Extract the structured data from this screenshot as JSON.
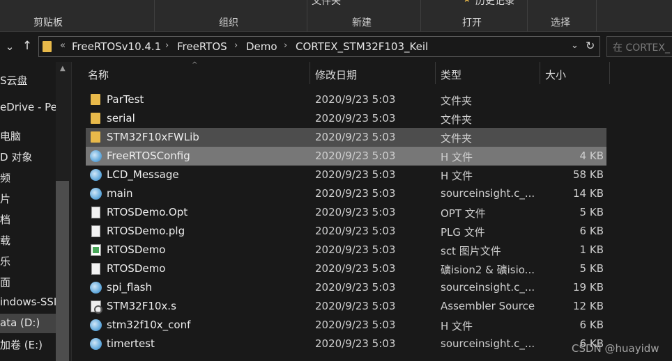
{
  "ribbon": {
    "top_labels": {
      "new_folder": "文件夹",
      "history": "历史记录"
    },
    "groups": {
      "clipboard": "剪贴板",
      "organize": "组织",
      "new": "新建",
      "open": "打开",
      "select": "选择"
    }
  },
  "nav": {
    "down_icon": "chevron-down-icon",
    "up_icon": "arrow-up-icon"
  },
  "address": {
    "overflow": "«",
    "crumbs": [
      "FreeRTOSv10.4.1",
      "FreeRTOS",
      "Demo",
      "CORTEX_STM32F103_Keil"
    ],
    "separator": "›"
  },
  "search": {
    "placeholder": "在 CORTEX_"
  },
  "sidebar": {
    "items": [
      {
        "label": "S云盘"
      },
      {
        "label": "eDrive - Per"
      },
      {
        "label": "电脑"
      },
      {
        "label": "D 对象"
      },
      {
        "label": "频"
      },
      {
        "label": "片"
      },
      {
        "label": "档"
      },
      {
        "label": "载"
      },
      {
        "label": "乐"
      },
      {
        "label": "面"
      },
      {
        "label": "indows-SSI"
      },
      {
        "label": "ata (D:)"
      },
      {
        "label": "加卷 (E:)"
      }
    ]
  },
  "columns": {
    "name": "名称",
    "date": "修改日期",
    "type": "类型",
    "size": "大小"
  },
  "files": [
    {
      "name": "ParTest",
      "date": "2020/9/23 5:03",
      "type": "文件夹",
      "size": "",
      "icon": "folder"
    },
    {
      "name": "serial",
      "date": "2020/9/23 5:03",
      "type": "文件夹",
      "size": "",
      "icon": "folder"
    },
    {
      "name": "STM32F10xFWLib",
      "date": "2020/9/23 5:03",
      "type": "文件夹",
      "size": "",
      "icon": "folder"
    },
    {
      "name": "FreeRTOSConfig",
      "date": "2020/9/23 5:03",
      "type": "H 文件",
      "size": "4 KB",
      "icon": "h"
    },
    {
      "name": "LCD_Message",
      "date": "2020/9/23 5:03",
      "type": "H 文件",
      "size": "58 KB",
      "icon": "h"
    },
    {
      "name": "main",
      "date": "2020/9/23 5:03",
      "type": "sourceinsight.c_...",
      "size": "14 KB",
      "icon": "h"
    },
    {
      "name": "RTOSDemo.Opt",
      "date": "2020/9/23 5:03",
      "type": "OPT 文件",
      "size": "5 KB",
      "icon": "doc"
    },
    {
      "name": "RTOSDemo.plg",
      "date": "2020/9/23 5:03",
      "type": "PLG 文件",
      "size": "6 KB",
      "icon": "doc"
    },
    {
      "name": "RTOSDemo",
      "date": "2020/9/23 5:03",
      "type": "sct 图片文件",
      "size": "1 KB",
      "icon": "sct"
    },
    {
      "name": "RTOSDemo",
      "date": "2020/9/23 5:03",
      "type": "礦ision2 & 礦isio...",
      "size": "5 KB",
      "icon": "doc"
    },
    {
      "name": "spi_flash",
      "date": "2020/9/23 5:03",
      "type": "sourceinsight.c_...",
      "size": "19 KB",
      "icon": "h"
    },
    {
      "name": "STM32F10x.s",
      "date": "2020/9/23 5:03",
      "type": "Assembler Source",
      "size": "12 KB",
      "icon": "asm"
    },
    {
      "name": "stm32f10x_conf",
      "date": "2020/9/23 5:03",
      "type": "H 文件",
      "size": "6 KB",
      "icon": "h"
    },
    {
      "name": "timertest",
      "date": "2020/9/23 5:03",
      "type": "sourceinsight.c_...",
      "size": "6 KB",
      "icon": "h"
    }
  ],
  "watermark": "CSDN @huayidw",
  "colors": {
    "background": "#191919",
    "selected_row": "#777777",
    "hover_row": "#4d4d4d",
    "folder": "#e8b94a"
  }
}
